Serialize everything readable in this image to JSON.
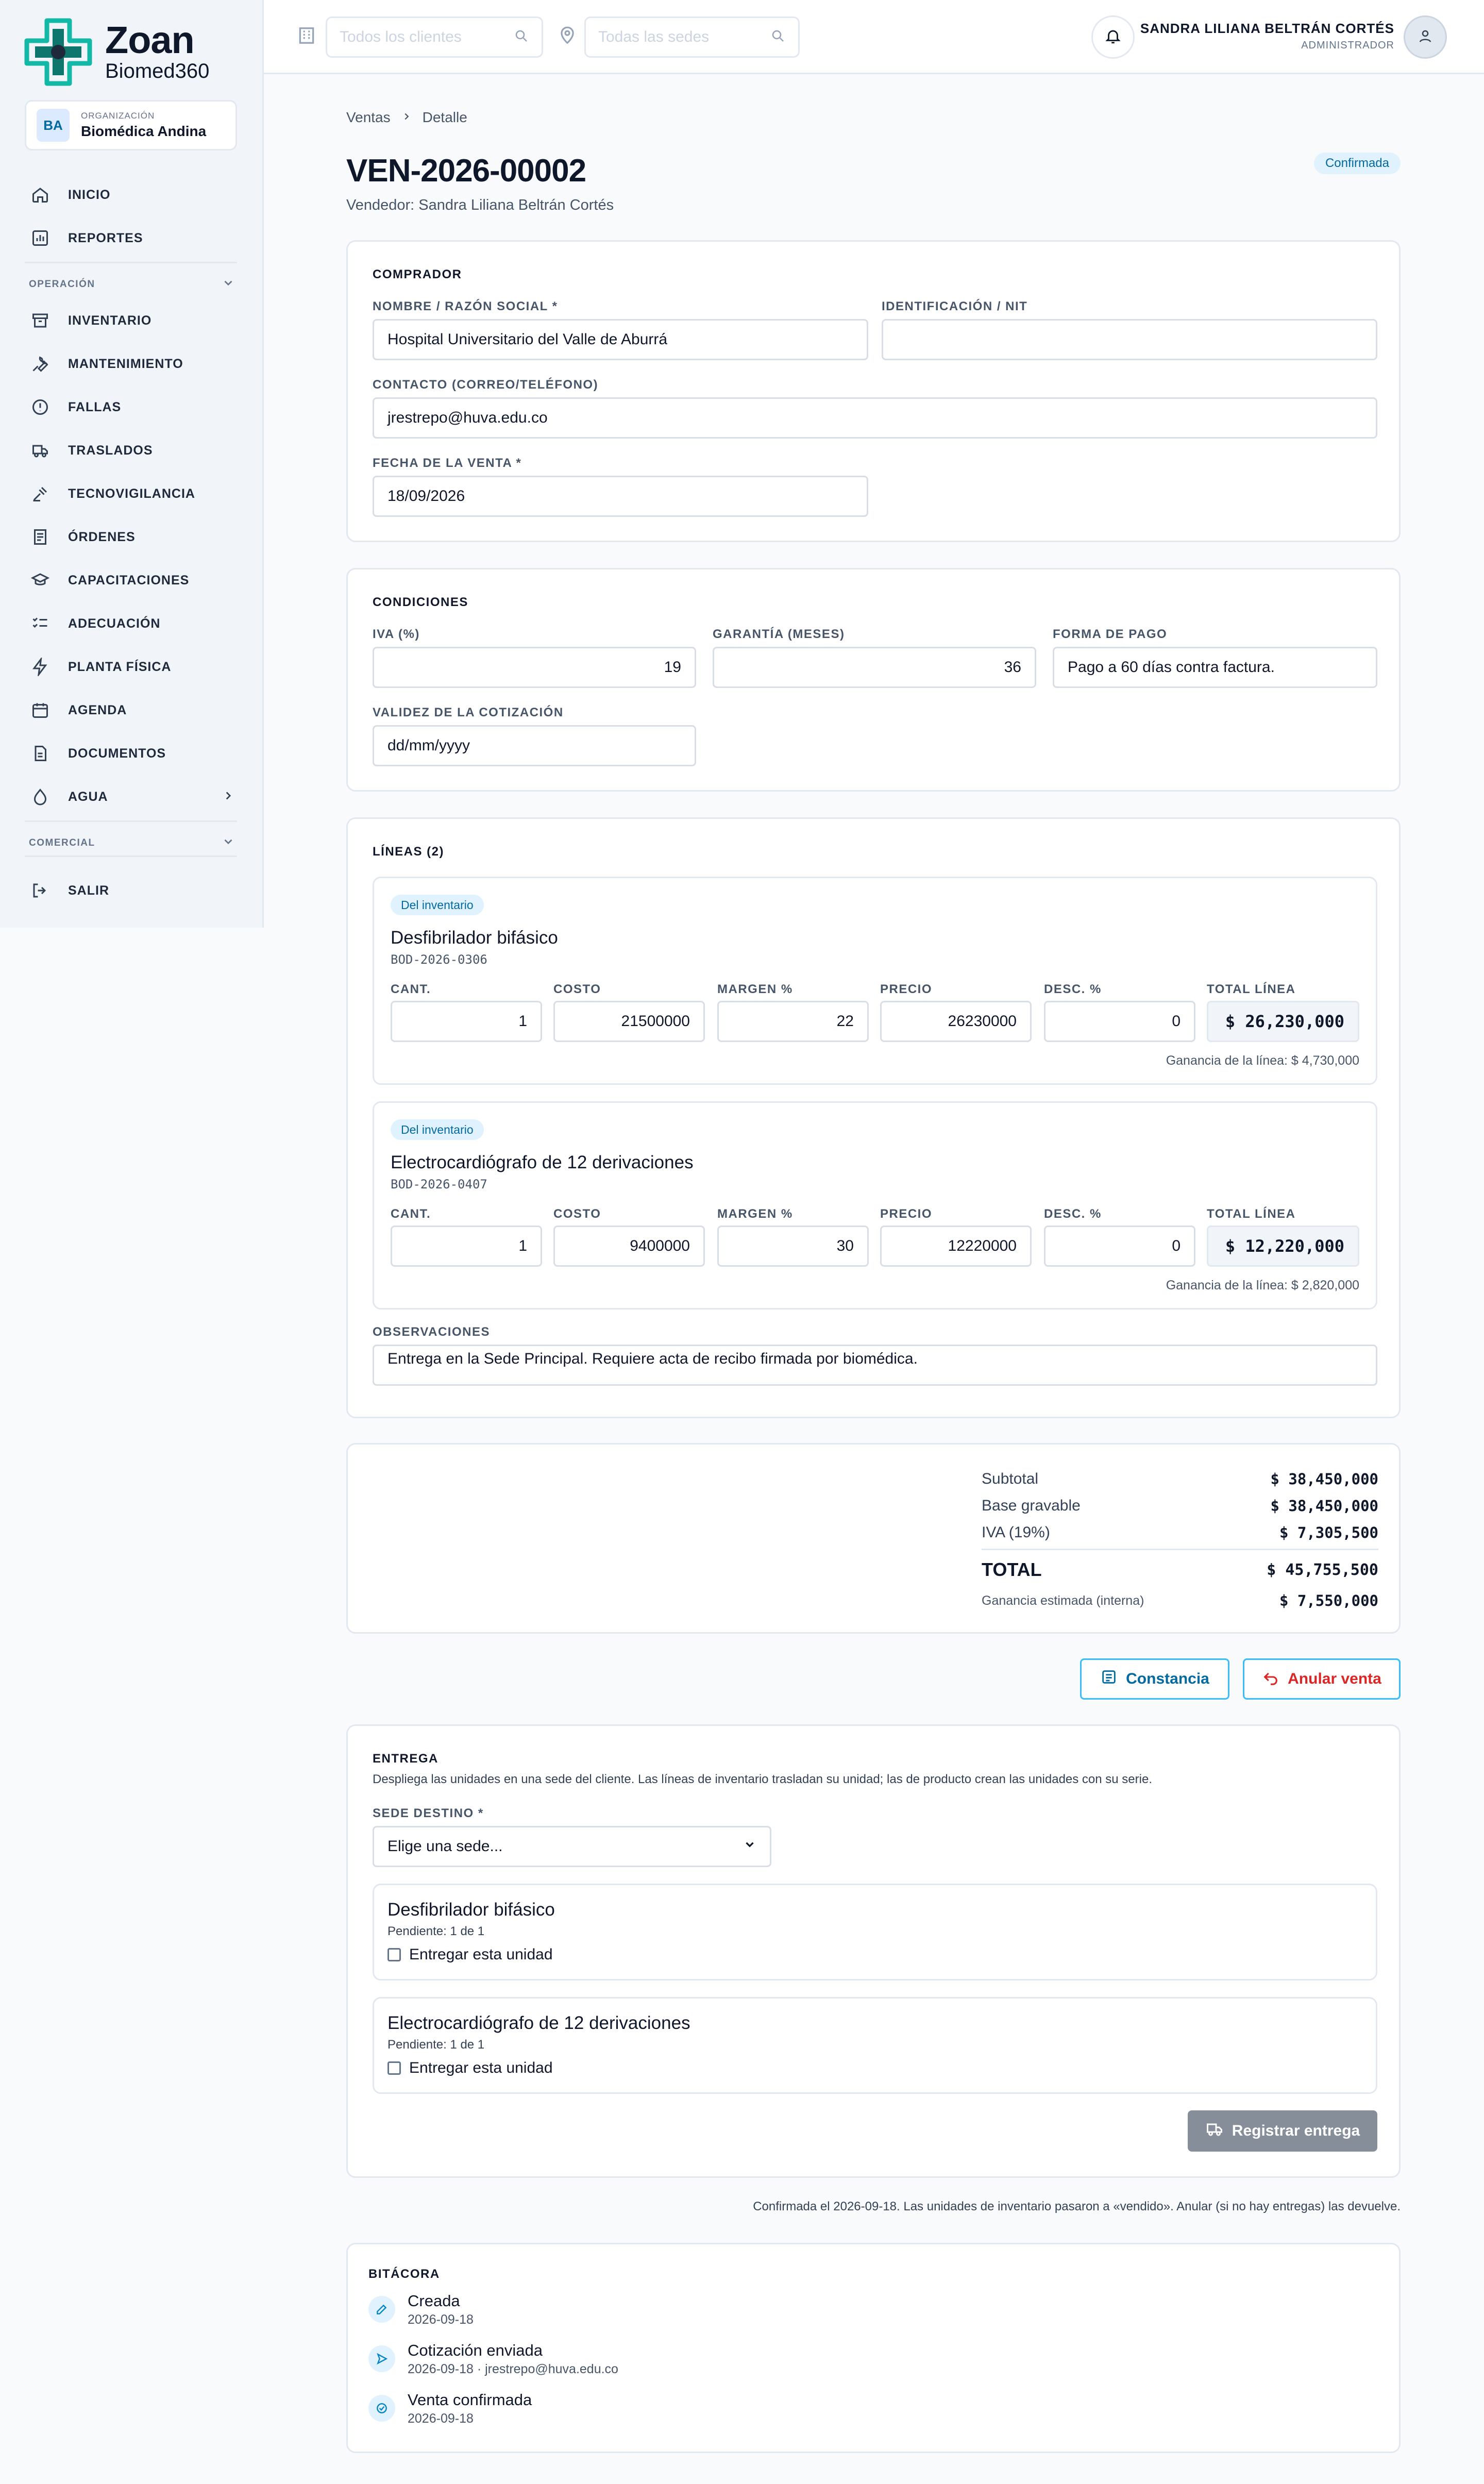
{
  "app": {
    "name": "Zoan",
    "subtitle": "Biomed360"
  },
  "org": {
    "initials": "BA",
    "label": "ORGANIZACIÓN",
    "name": "Biomédica Andina"
  },
  "nav": {
    "inicio": "INICIO",
    "reportes": "REPORTES",
    "section_operacion": "OPERACIÓN",
    "inventario": "INVENTARIO",
    "mantenimiento": "MANTENIMIENTO",
    "fallas": "FALLAS",
    "traslados": "TRASLADOS",
    "tecnovigilancia": "TECNOVIGILANCIA",
    "ordenes": "ÓRDENES",
    "capacitaciones": "CAPACITACIONES",
    "adecuacion": "ADECUACIÓN",
    "planta": "PLANTA FÍSICA",
    "agenda": "AGENDA",
    "documentos": "DOCUMENTOS",
    "agua": "AGUA",
    "section_comercial": "COMERCIAL",
    "salir": "SALIR"
  },
  "topbar": {
    "clients_placeholder": "Todos los clientes",
    "sites_placeholder": "Todas las sedes",
    "user_name": "SANDRA LILIANA BELTRÁN CORTÉS",
    "user_role": "ADMINISTRADOR"
  },
  "breadcrumb": {
    "parent": "Ventas",
    "current": "Detalle"
  },
  "sale": {
    "code": "VEN-2026-00002",
    "vendor": "Vendedor: Sandra Liliana Beltrán Cortés",
    "status": "Confirmada"
  },
  "buyer": {
    "title": "COMPRADOR",
    "name_label": "NOMBRE / RAZÓN SOCIAL *",
    "name_value": "Hospital Universitario del Valle de Aburrá",
    "id_label": "IDENTIFICACIÓN / NIT",
    "id_value": "",
    "contact_label": "CONTACTO (CORREO/TELÉFONO)",
    "contact_value": "jrestrepo@huva.edu.co",
    "date_label": "FECHA DE LA VENTA *",
    "date_value": "18/09/2026"
  },
  "conditions": {
    "title": "CONDICIONES",
    "iva_label": "IVA (%)",
    "iva_value": "19",
    "warranty_label": "GARANTÍA (MESES)",
    "warranty_value": "36",
    "payment_label": "FORMA DE PAGO",
    "payment_value": "Pago a 60 días contra factura.",
    "validity_label": "VALIDEZ DE LA COTIZACIÓN",
    "validity_value": "dd/mm/yyyy"
  },
  "lines": {
    "title": "LÍNEAS (2)",
    "col_qty": "CANT.",
    "col_cost": "COSTO",
    "col_margin": "MARGEN %",
    "col_price": "PRECIO",
    "col_disc": "DESC. %",
    "col_total": "TOTAL LÍNEA",
    "items": [
      {
        "tag": "Del inventario",
        "name": "Desfibrilador bifásico",
        "code": "BOD-2026-0306",
        "qty": "1",
        "cost": "21500000",
        "margin": "22",
        "price": "26230000",
        "disc": "0",
        "total": "$ 26,230,000",
        "profit": "Ganancia de la línea: $ 4,730,000"
      },
      {
        "tag": "Del inventario",
        "name": "Electrocardiógrafo de 12 derivaciones",
        "code": "BOD-2026-0407",
        "qty": "1",
        "cost": "9400000",
        "margin": "30",
        "price": "12220000",
        "disc": "0",
        "total": "$ 12,220,000",
        "profit": "Ganancia de la línea: $ 2,820,000"
      }
    ],
    "obs_label": "OBSERVACIONES",
    "obs_value": "Entrega en la Sede Principal. Requiere acta de recibo firmada por biomédica."
  },
  "summary": {
    "subtotal_label": "Subtotal",
    "subtotal": "$ 38,450,000",
    "base_label": "Base gravable",
    "base": "$ 38,450,000",
    "iva_label": "IVA (19%)",
    "iva": "$ 7,305,500",
    "total_label": "TOTAL",
    "total": "$ 45,755,500",
    "profit_label": "Ganancia estimada (interna)",
    "profit": "$ 7,550,000"
  },
  "actions": {
    "constancia": "Constancia",
    "anular": "Anular venta"
  },
  "delivery": {
    "title": "ENTREGA",
    "desc": "Despliega las unidades en una sede del cliente. Las líneas de inventario trasladan su unidad; las de producto crean las unidades con su serie.",
    "site_label": "SEDE DESTINO *",
    "site_value": "Elige una sede...",
    "items": [
      {
        "name": "Desfibrilador bifásico",
        "pending": "Pendiente: 1 de 1",
        "check": "Entregar esta unidad"
      },
      {
        "name": "Electrocardiógrafo de 12 derivaciones",
        "pending": "Pendiente: 1 de 1",
        "check": "Entregar esta unidad"
      }
    ],
    "button": "Registrar entrega"
  },
  "note": "Confirmada el 2026-09-18. Las unidades de inventario pasaron a «vendido». Anular (si no hay entregas) las devuelve.",
  "log": {
    "title": "BITÁCORA",
    "items": [
      {
        "title": "Creada",
        "date": "2026-09-18"
      },
      {
        "title": "Cotización enviada",
        "date": "2026-09-18 · jrestrepo@huva.edu.co"
      },
      {
        "title": "Venta confirmada",
        "date": "2026-09-18"
      }
    ]
  },
  "colors": {
    "accent": "#0ea5e9",
    "danger": "#dc2626",
    "brand": "#0d9488"
  }
}
